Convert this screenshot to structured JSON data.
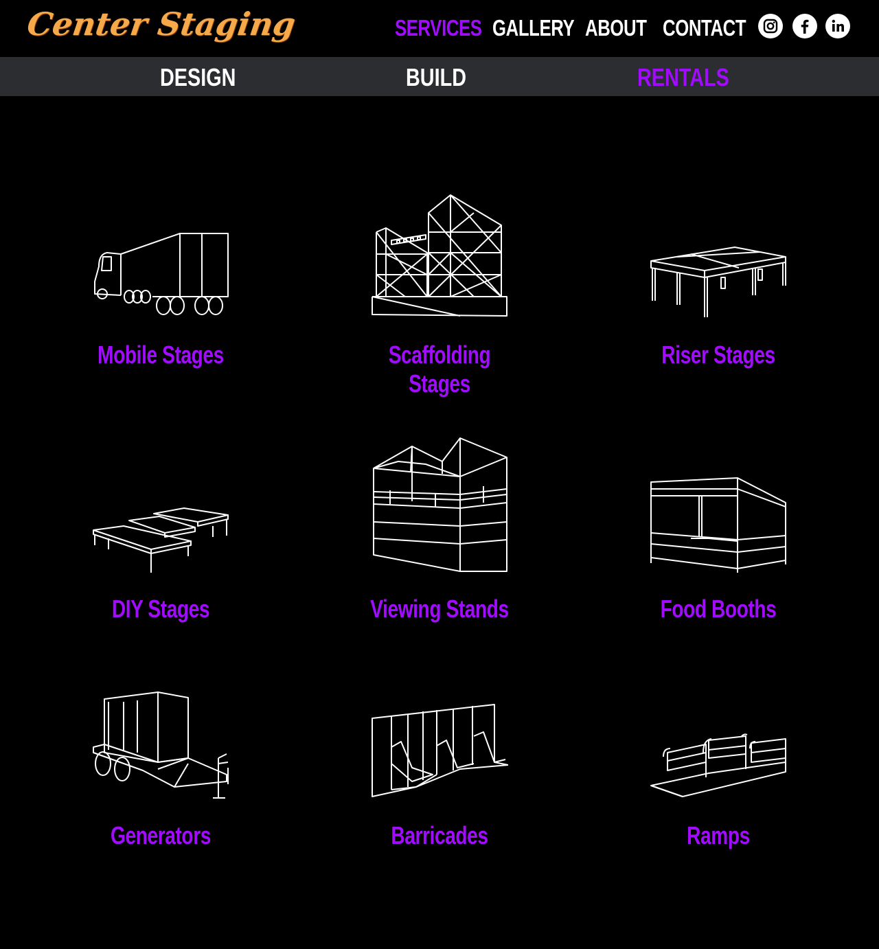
{
  "brand": {
    "name": "Center Staging"
  },
  "nav": {
    "services": "SERVICES",
    "gallery": "GALLERY",
    "about": "ABOUT",
    "contact": "CONTACT"
  },
  "social": [
    "instagram-icon",
    "facebook-icon",
    "linkedin-icon"
  ],
  "subnav": {
    "design": "DESIGN",
    "build": "BUILD",
    "rentals": "RENTALS"
  },
  "colors": {
    "accent": "#a10cff",
    "logo": "#f5a94a",
    "subnav_bg": "#2b2d30",
    "background": "#000000"
  },
  "rentals": [
    {
      "label": "Mobile Stages",
      "icon": "truck-stage-icon"
    },
    {
      "label": "Scaffolding Stages",
      "icon": "scaffold-icon"
    },
    {
      "label": "Riser Stages",
      "icon": "riser-icon"
    },
    {
      "label": "DIY Stages",
      "icon": "diy-platform-icon"
    },
    {
      "label": "Viewing Stands",
      "icon": "viewing-stand-icon"
    },
    {
      "label": "Food Booths",
      "icon": "booth-icon"
    },
    {
      "label": "Generators",
      "icon": "generator-trailer-icon"
    },
    {
      "label": "Barricades",
      "icon": "barricade-icon"
    },
    {
      "label": "Ramps",
      "icon": "ramp-icon"
    }
  ]
}
